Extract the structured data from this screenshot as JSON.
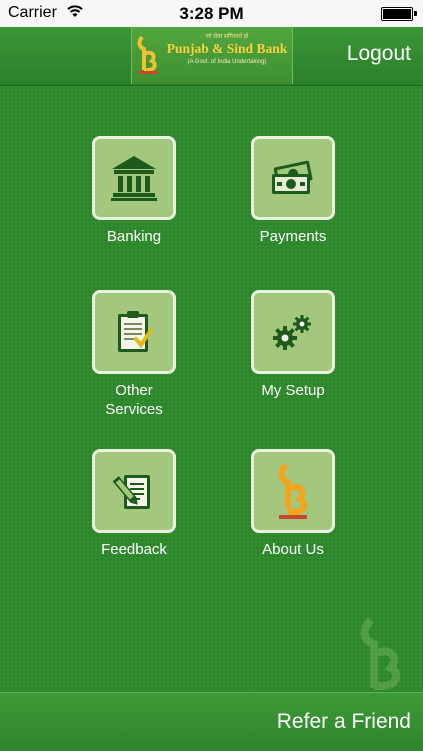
{
  "status_bar": {
    "carrier": "Carrier",
    "time": "3:28 PM"
  },
  "header": {
    "logo": {
      "hindi_tagline": "जो सेवा सगिथार्थ हो",
      "bank_name": "Punjab & Sind Bank",
      "subtitle": "(A Govt. of India Undertaking)",
      "mark_text": "पंजाब"
    },
    "logout_label": "Logout"
  },
  "menu": [
    {
      "label": "Banking",
      "icon": "bank-icon"
    },
    {
      "label": "Payments",
      "icon": "money-icon"
    },
    {
      "label": "Other\nServices",
      "icon": "clipboard-icon"
    },
    {
      "label": "My Setup",
      "icon": "gears-icon"
    },
    {
      "label": "Feedback",
      "icon": "feedback-icon"
    },
    {
      "label": "About Us",
      "icon": "bank-logo-icon"
    }
  ],
  "footer": {
    "refer_label": "Refer a Friend"
  },
  "colors": {
    "background": "#318d2e",
    "tile": "#a2c77d",
    "tile_border": "#e9f3df",
    "icon": "#1e5a1c",
    "logo_gold": "#f7d23e"
  }
}
